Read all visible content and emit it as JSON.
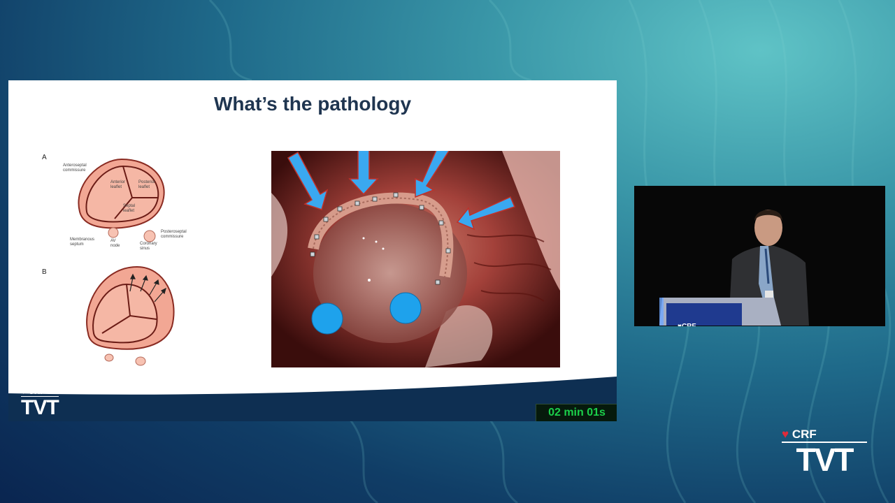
{
  "slide": {
    "title": "What’s the pathology",
    "diagram": {
      "label_a": "A",
      "label_b": "B",
      "anteroseptal_1": "Anteroseptal",
      "anteroseptal_2": "commissure",
      "anterior_1": "Anterior",
      "anterior_2": "leaflet",
      "posterior_1": "Posterior",
      "posterior_2": "leaflet",
      "septal_1": "Septal",
      "septal_2": "leaflet",
      "posteroseptal_1": "Posteroseptal",
      "posteroseptal_2": "commissure",
      "membranous_1": "Membranous",
      "membranous_2": "septum",
      "av_1": "AV",
      "av_2": "node",
      "coronary_1": "Coronary",
      "coronary_2": "sinus"
    },
    "footer": {
      "crf": "CRF",
      "tvt": "TVT"
    },
    "timer": "02 min 01s"
  },
  "branding": {
    "crf": "CRF",
    "tvt": "TVT"
  },
  "colors": {
    "arrow": "#3aa8f0",
    "title": "#1f3550",
    "timer": "#1bd04a",
    "leaflet": "#f2a794"
  }
}
